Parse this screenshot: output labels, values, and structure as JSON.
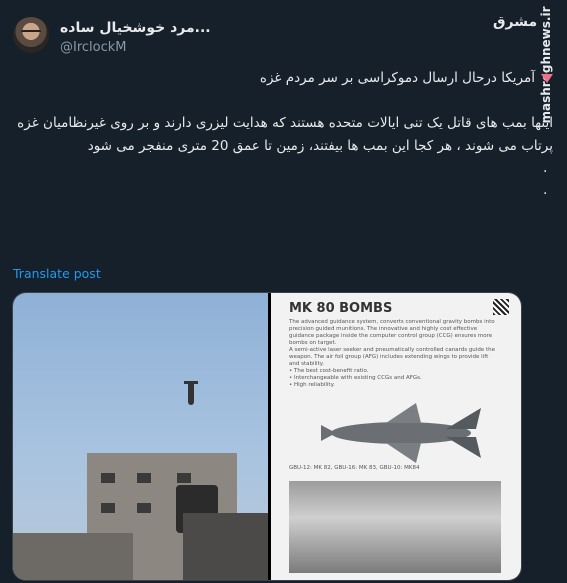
{
  "tweet": {
    "display_name": "...مرد خوشخیال ساده",
    "handle": "@IrclockM",
    "headline": "آمریکا درحال ارسال دموکراسی بر سر مردم غزه",
    "body": "اینها بمب های قاتل یک تنی ایالات متحده هستند که هدایت لیزری دارند و بر روی غیرنظامیان غزه پرتاب می شوند ، هر کجا این بمب ها بیفتند، زمین تا عمق 20 متری منفجر می شود",
    "dot1": ".",
    "dot2": ".",
    "translate_label": "Translate post"
  },
  "watermark": {
    "logo_text": "مشرق",
    "site": "mashreghnews.ir"
  },
  "media": {
    "doc_title": "MK 80 BOMBS",
    "doc_para1": "The advanced guidance system, converts conventional gravity bombs into precision guided munitions. The innovative and highly cost effective guidance package inside the computer control group (CCG) ensures more bombs on target.",
    "doc_para2": "A semi-active laser seeker and pneumatically controlled canards guide the weapon. The air foil group (AFG) includes extending wings to provide lift and stability.",
    "bullets": [
      "• The best cost-benefit ratio.",
      "• Interchangeable with existing CCGs and AFGs.",
      "• High reliability."
    ],
    "doc_caption": "GBU-12: MK 82, GBU-16: MK 83, GBU-10: MK84"
  },
  "colors": {
    "background": "#15202b",
    "link": "#1d9bf0",
    "triangle": "#f0728a"
  }
}
